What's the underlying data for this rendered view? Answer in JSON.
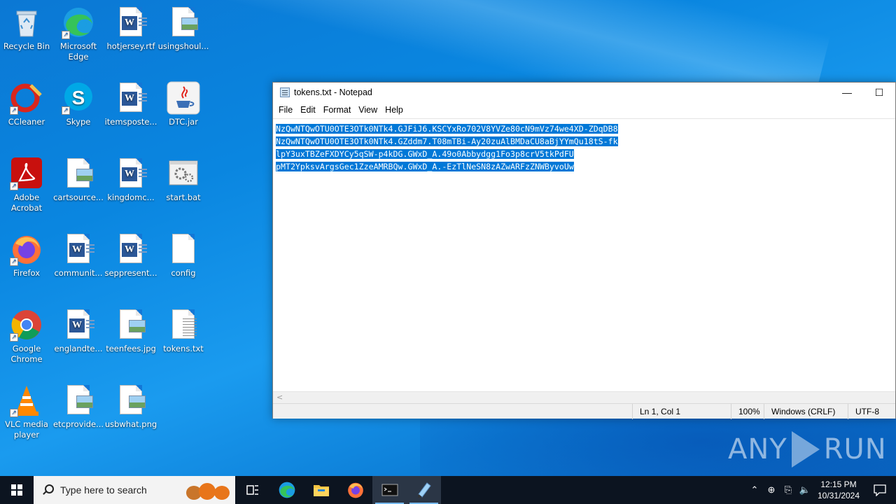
{
  "desktop": {
    "icons": [
      {
        "label": "Recycle Bin",
        "icon": "recycle-bin-icon"
      },
      {
        "label": "Microsoft Edge",
        "icon": "edge-icon"
      },
      {
        "label": "hotjersey.rtf",
        "icon": "word-document-icon"
      },
      {
        "label": "usingshoul...",
        "icon": "image-file-icon"
      },
      {
        "label": "CCleaner",
        "icon": "ccleaner-icon"
      },
      {
        "label": "Skype",
        "icon": "skype-icon"
      },
      {
        "label": "itemsposte...",
        "icon": "word-document-icon"
      },
      {
        "label": "DTC.jar",
        "icon": "java-jar-icon"
      },
      {
        "label": "Adobe Acrobat",
        "icon": "acrobat-icon"
      },
      {
        "label": "cartsource...",
        "icon": "image-file-icon"
      },
      {
        "label": "kingdomc...",
        "icon": "word-document-icon"
      },
      {
        "label": "start.bat",
        "icon": "batch-file-icon"
      },
      {
        "label": "Firefox",
        "icon": "firefox-icon"
      },
      {
        "label": "communit...",
        "icon": "word-document-icon"
      },
      {
        "label": "seppresent...",
        "icon": "word-document-icon"
      },
      {
        "label": "config",
        "icon": "blank-file-icon"
      },
      {
        "label": "Google Chrome",
        "icon": "chrome-icon"
      },
      {
        "label": "englandte...",
        "icon": "word-document-icon"
      },
      {
        "label": "teenfees.jpg",
        "icon": "image-file-icon"
      },
      {
        "label": "tokens.txt",
        "icon": "text-file-icon"
      },
      {
        "label": "VLC media player",
        "icon": "vlc-icon"
      },
      {
        "label": "etcprovide...",
        "icon": "image-file-icon"
      },
      {
        "label": "usbwhat.png",
        "icon": "image-file-icon"
      }
    ]
  },
  "notepad": {
    "title": "tokens.txt - Notepad",
    "controls": {
      "minimize": "—",
      "maximize": "☐"
    },
    "menu": [
      "File",
      "Edit",
      "Format",
      "View",
      "Help"
    ],
    "lines": [
      "NzQwNTQwOTU0OTE3OTk0NTk4.GJFiJ6.KSCYxRo702V8YVZe80cN9mVz74we4XD-ZDqDB8",
      "NzQwNTQwOTU0OTE3OTk0NTk4.GZddm7.T08mTBi-Ay20zuAlBMDaCU8aBjYYmQu18tS-fk",
      "lpY3uxTBZeFXDYCy5qSW-p4kDG.GWxD_A.49o0Abbydgg1Fo3p8crV5tkPdFU",
      "pMT2YpksvArgsGec1ZzeAMRBQw.GWxD_A.-EzTlNeSN8zAZwARFzZNWByvoUw"
    ],
    "status": {
      "position": "Ln 1, Col 1",
      "zoom": "100%",
      "line_ending": "Windows (CRLF)",
      "encoding": "UTF-8"
    },
    "selection_color": "#0078d7"
  },
  "watermark": {
    "left": "ANY",
    "right": "RUN"
  },
  "taskbar": {
    "search_placeholder": "Type here to search",
    "apps": [
      "task-view-icon",
      "edge-icon",
      "file-explorer-icon",
      "firefox-icon",
      "terminal-icon",
      "notepad-icon"
    ],
    "clock_time": "12:15 PM",
    "clock_date": "10/31/2024"
  }
}
